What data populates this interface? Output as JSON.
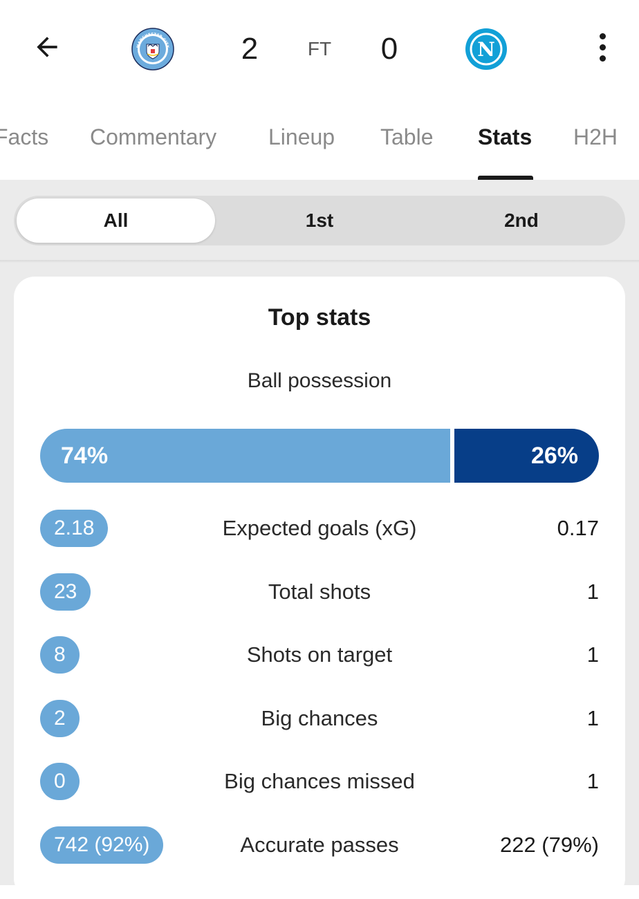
{
  "header": {
    "back_icon": "arrow-left-icon",
    "home_team_logo": "manchester-city-crest",
    "away_team_logo": "napoli-crest",
    "home_logo_text": "MANCHESTER CITY",
    "away_logo_text": "N",
    "home_score": "2",
    "status": "FT",
    "away_score": "0",
    "more_icon": "more-vertical-icon"
  },
  "tabs": [
    {
      "label": "Facts"
    },
    {
      "label": "Commentary"
    },
    {
      "label": "Lineup"
    },
    {
      "label": "Table"
    },
    {
      "label": "Stats",
      "active": true
    },
    {
      "label": "H2H"
    }
  ],
  "periods": [
    {
      "label": "All",
      "active": true
    },
    {
      "label": "1st"
    },
    {
      "label": "2nd"
    }
  ],
  "top_stats": {
    "title": "Top stats",
    "possession": {
      "label": "Ball possession",
      "home": "74%",
      "away": "26%",
      "home_fraction": 0.74
    },
    "rows": [
      {
        "label": "Expected goals (xG)",
        "home": "2.18",
        "away": "0.17"
      },
      {
        "label": "Total shots",
        "home": "23",
        "away": "1"
      },
      {
        "label": "Shots on target",
        "home": "8",
        "away": "1"
      },
      {
        "label": "Big chances",
        "home": "2",
        "away": "1"
      },
      {
        "label": "Big chances missed",
        "home": "0",
        "away": "1"
      },
      {
        "label": "Accurate passes",
        "home": "742 (92%)",
        "away": "222 (79%)"
      }
    ]
  },
  "colors": {
    "home": "#6aa8d8",
    "away": "#073e88",
    "accent_text": "#1a1a1a"
  }
}
